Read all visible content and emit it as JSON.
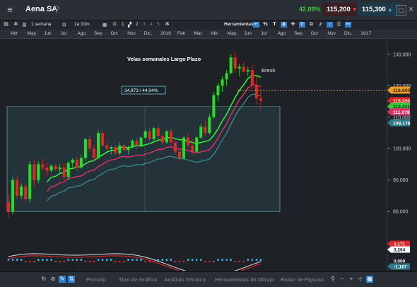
{
  "header": {
    "menu_icon": "hamburger-icon",
    "title": "Aena SA",
    "search_icon": "search-icon",
    "change_pct": "42,09%",
    "sell_price": "115,200",
    "buy_price": "115,300",
    "buttons": [
      "minimize-icon",
      "restore-icon",
      "close-icon"
    ]
  },
  "toolbar": {
    "period": "1 semana",
    "range": "1a 10m",
    "candle_label": "D",
    "chart_numbers": [
      "1",
      "2",
      "3",
      "4",
      "5"
    ],
    "tools_label": "Herramientas",
    "tool_icons": [
      "undo-icon",
      "percent-icon",
      "text-icon",
      "grid-icon",
      "crosshair-icon",
      "zero-icon",
      "clone-icon",
      "draw-icon",
      "link-icon",
      "print-icon",
      "share-icon"
    ]
  },
  "timeline": {
    "months": [
      "Abr",
      "May.",
      "Jun",
      "Jul",
      "Ago.",
      "Sep",
      "Oct",
      "Nov.",
      "Dic.",
      "2016",
      "Feb",
      "Mar",
      "Abr",
      "May.",
      "Jun",
      "Jul",
      "Ago",
      "Sep",
      "Oct",
      "Nov",
      "Dic.",
      "2017"
    ]
  },
  "chart": {
    "annotation_title": "Velas semanales Largo Plazo",
    "brexit_label": "Brexit",
    "measure_label": "34,973 / 44,04%",
    "price_labels": {
      "level_line": "118,600",
      "current": "115,250",
      "green_ma": "113,421",
      "red_ma": "111,678",
      "teal_ma": "108,178"
    },
    "colors": {
      "bull": "#22e022",
      "bear": "#e02828",
      "ma_green": "#33ff33",
      "ma_red": "#e0306a",
      "ma_teal": "#3a8a8a",
      "level": "#f0a020"
    }
  },
  "chart_data": {
    "type": "candlestick",
    "title": "Velas semanales Largo Plazo",
    "y_ticks": [
      "130,000",
      "120,000",
      "110,000",
      "100,000",
      "90,000",
      "80,000"
    ],
    "ylim": [
      76,
      134
    ],
    "candles": [
      [
        83,
        85.5,
        78,
        80
      ],
      [
        80,
        91,
        79,
        90
      ],
      [
        90,
        91,
        84,
        85
      ],
      [
        85,
        89,
        84,
        88
      ],
      [
        88,
        89,
        83,
        84
      ],
      [
        84,
        96,
        83,
        95
      ],
      [
        95,
        96.5,
        88,
        90
      ],
      [
        90,
        96,
        89,
        95
      ],
      [
        95,
        97,
        93,
        94
      ],
      [
        94,
        95.5,
        91,
        93
      ],
      [
        93,
        95,
        92.5,
        94.5
      ],
      [
        94.5,
        95,
        93,
        93.5
      ],
      [
        93.5,
        95,
        92,
        94
      ],
      [
        94,
        95.5,
        90,
        91
      ],
      [
        91,
        96,
        90,
        95.5
      ],
      [
        95.5,
        97,
        94,
        96.5
      ],
      [
        96.5,
        97.5,
        93,
        94
      ],
      [
        94,
        98,
        93.5,
        97
      ],
      [
        97,
        103.5,
        96,
        103
      ],
      [
        103,
        104,
        99,
        100
      ],
      [
        100,
        101,
        96,
        97
      ],
      [
        97,
        106,
        96.5,
        105
      ],
      [
        105,
        106,
        100.5,
        101
      ],
      [
        101,
        102,
        99,
        100
      ],
      [
        100,
        101,
        98,
        100.5
      ],
      [
        100.5,
        101,
        98,
        98.5
      ],
      [
        98.5,
        102,
        98,
        101
      ],
      [
        101,
        102,
        99,
        99.5
      ],
      [
        99.5,
        101,
        98,
        100.5
      ],
      [
        100.5,
        103,
        100,
        102.5
      ],
      [
        102.5,
        103.5,
        100,
        101
      ],
      [
        101,
        104,
        100.5,
        103.5
      ],
      [
        103.5,
        106,
        103,
        105.5
      ],
      [
        105.5,
        106.5,
        102,
        103
      ],
      [
        103,
        107,
        102.5,
        106.5
      ],
      [
        106.5,
        107.5,
        103,
        104
      ],
      [
        104,
        105,
        101,
        102
      ],
      [
        102,
        106,
        101.5,
        105.5
      ],
      [
        105.5,
        106.5,
        101,
        102
      ],
      [
        102,
        103,
        98,
        99
      ],
      [
        99,
        100,
        96,
        97
      ],
      [
        97,
        104,
        96.5,
        103.5
      ],
      [
        103.5,
        105,
        100,
        101
      ],
      [
        101,
        103,
        98,
        99
      ],
      [
        99,
        104,
        98.5,
        103.5
      ],
      [
        103.5,
        108,
        103,
        107
      ],
      [
        107,
        109,
        104,
        105
      ],
      [
        105,
        111,
        104.5,
        110
      ],
      [
        110,
        118,
        109.5,
        117
      ],
      [
        117,
        121,
        115,
        120
      ],
      [
        120,
        123,
        118,
        122
      ],
      [
        122,
        125,
        120,
        124
      ],
      [
        124,
        130,
        123.5,
        129
      ],
      [
        129,
        131,
        124,
        125.5
      ],
      [
        125.5,
        127,
        123,
        126
      ],
      [
        126,
        127.5,
        124,
        124.5
      ],
      [
        124.5,
        126,
        123,
        125
      ],
      [
        125,
        126.5,
        119,
        120
      ],
      [
        120,
        123,
        114,
        116
      ],
      [
        116,
        119,
        112,
        115.25
      ]
    ],
    "indicator_ticks": [
      "4,171",
      "3,264",
      "0,000",
      "-1,167"
    ]
  },
  "footer": {
    "icons": [
      "refresh-icon",
      "block-icon",
      "pencil-icon",
      "swap-icon"
    ],
    "tabs": [
      "Período",
      "Tipo de Gráfico",
      "Análisis Técnico",
      "Herramientas de Dibujo",
      "Radar de Figuras"
    ],
    "right_icons": [
      "zoom-icon",
      "minus-icon",
      "plus-icon",
      "fit-icon",
      "calendar-icon"
    ]
  }
}
